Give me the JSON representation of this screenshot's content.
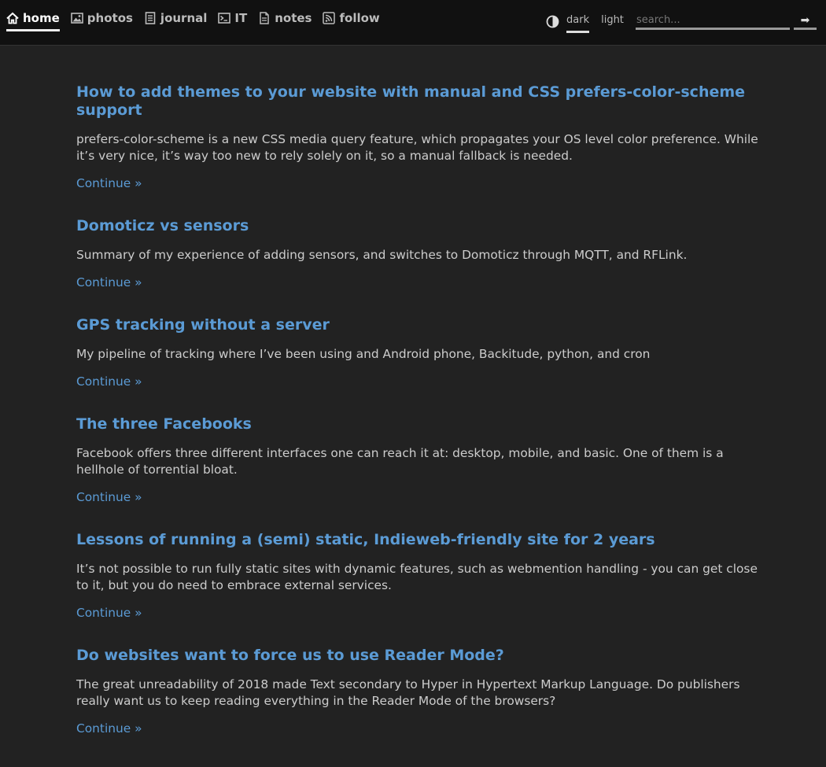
{
  "nav": {
    "items": [
      {
        "label": "home",
        "icon": "home-icon",
        "active": true
      },
      {
        "label": "photos",
        "icon": "photo-icon",
        "active": false
      },
      {
        "label": "journal",
        "icon": "journal-icon",
        "active": false
      },
      {
        "label": "IT",
        "icon": "terminal-icon",
        "active": false
      },
      {
        "label": "notes",
        "icon": "note-icon",
        "active": false
      },
      {
        "label": "follow",
        "icon": "rss-icon",
        "active": false
      }
    ]
  },
  "theme": {
    "icon": "contrast-icon",
    "options": [
      {
        "label": "dark",
        "active": true
      },
      {
        "label": "light",
        "active": false
      }
    ]
  },
  "search": {
    "placeholder": "search...",
    "value": "",
    "button_label": "➡"
  },
  "posts": [
    {
      "title": "How to add themes to your website with manual and CSS prefers-color-scheme support",
      "summary": "prefers-color-scheme is a new CSS media query feature, which propagates your OS level color preference. While it’s very nice, it’s way too new to rely solely on it, so a manual fallback is needed.",
      "link": "Continue »"
    },
    {
      "title": "Domoticz vs sensors",
      "summary": "Summary of my experience of adding sensors, and switches to Domoticz through MQTT, and RFLink.",
      "link": "Continue »"
    },
    {
      "title": "GPS tracking without a server",
      "summary": "My pipeline of tracking where I’ve been using and Android phone, Backitude, python, and cron",
      "link": "Continue »"
    },
    {
      "title": "The three Facebooks",
      "summary": "Facebook offers three different interfaces one can reach it at: desktop, mobile, and basic. One of them is a hellhole of torrential bloat.",
      "link": "Continue »"
    },
    {
      "title": "Lessons of running a (semi) static, Indieweb-friendly site for 2 years",
      "summary": "It’s not possible to run fully static sites with dynamic features, such as webmention handling - you can get close to it, but you do need to embrace external services.",
      "link": "Continue »"
    },
    {
      "title": "Do websites want to force us to use Reader Mode?",
      "summary": "The great unreadability of 2018 made Text secondary to Hyper in Hypertext Markup Language. Do publishers really want us to keep reading everything in the Reader Mode of the browsers?",
      "link": "Continue »"
    }
  ],
  "colors": {
    "background": "#222222",
    "header": "#111111",
    "accent": "#5b9bd5",
    "text": "#cccccc"
  }
}
